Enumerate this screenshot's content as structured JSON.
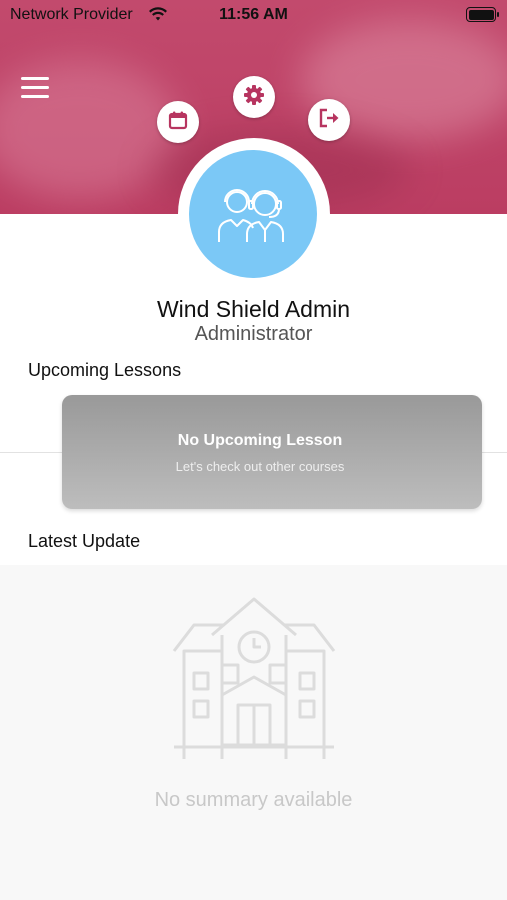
{
  "status_bar": {
    "carrier": "Network Provider",
    "time": "11:56 AM"
  },
  "header": {
    "menu_icon": "hamburger-menu-icon",
    "calendar_icon": "calendar-icon",
    "settings_icon": "gear-icon",
    "logout_icon": "logout-icon",
    "accent_color": "#b73560"
  },
  "profile": {
    "name": "Wind Shield Admin",
    "role": "Administrator",
    "avatar_icon": "support-agents-icon",
    "avatar_color": "#7bc8f6"
  },
  "upcoming": {
    "title": "Upcoming Lessons",
    "empty_title": "No Upcoming Lesson",
    "empty_subtitle": "Let's check out other courses"
  },
  "latest": {
    "title": "Latest Update",
    "empty_icon": "school-building-icon",
    "empty_text": "No summary available"
  }
}
